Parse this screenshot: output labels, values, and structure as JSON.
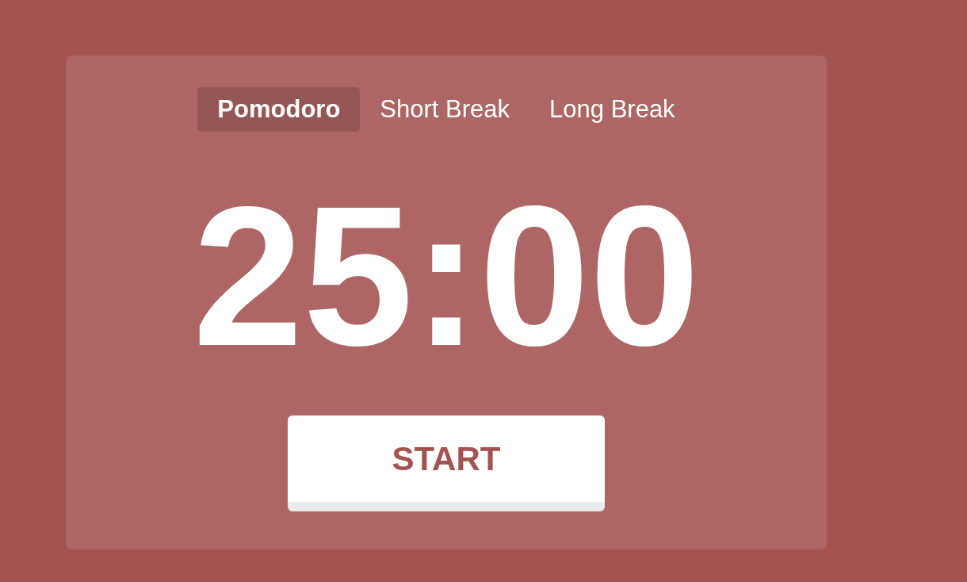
{
  "tabs": [
    {
      "label": "Pomodoro",
      "selected": true
    },
    {
      "label": "Short Break",
      "selected": false
    },
    {
      "label": "Long Break",
      "selected": false
    }
  ],
  "timer": {
    "time": "25:00"
  },
  "start_button": {
    "label": "START"
  }
}
